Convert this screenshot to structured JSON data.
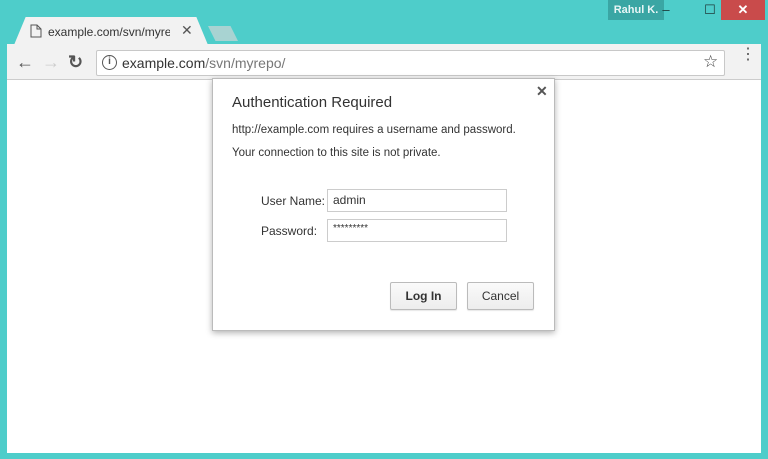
{
  "window": {
    "user": "Rahul K.",
    "minimize": "–",
    "maximize": "☐",
    "close": "✕"
  },
  "tab": {
    "title": "example.com/svn/myrepo/",
    "close": "✕"
  },
  "toolbar": {
    "back": "←",
    "forward": "→",
    "reload": "↻",
    "url_host": "example.com",
    "url_path": "/svn/myrepo/",
    "info": "i",
    "star": "☆",
    "menu": "⋮"
  },
  "dialog": {
    "title": "Authentication Required",
    "close": "✕",
    "message": "http://example.com requires a username and password.",
    "warning": "Your connection to this site is not private.",
    "username_label": "User Name:",
    "username_value": "admin",
    "password_label": "Password:",
    "password_value": "*********",
    "login_label": "Log In",
    "cancel_label": "Cancel"
  }
}
